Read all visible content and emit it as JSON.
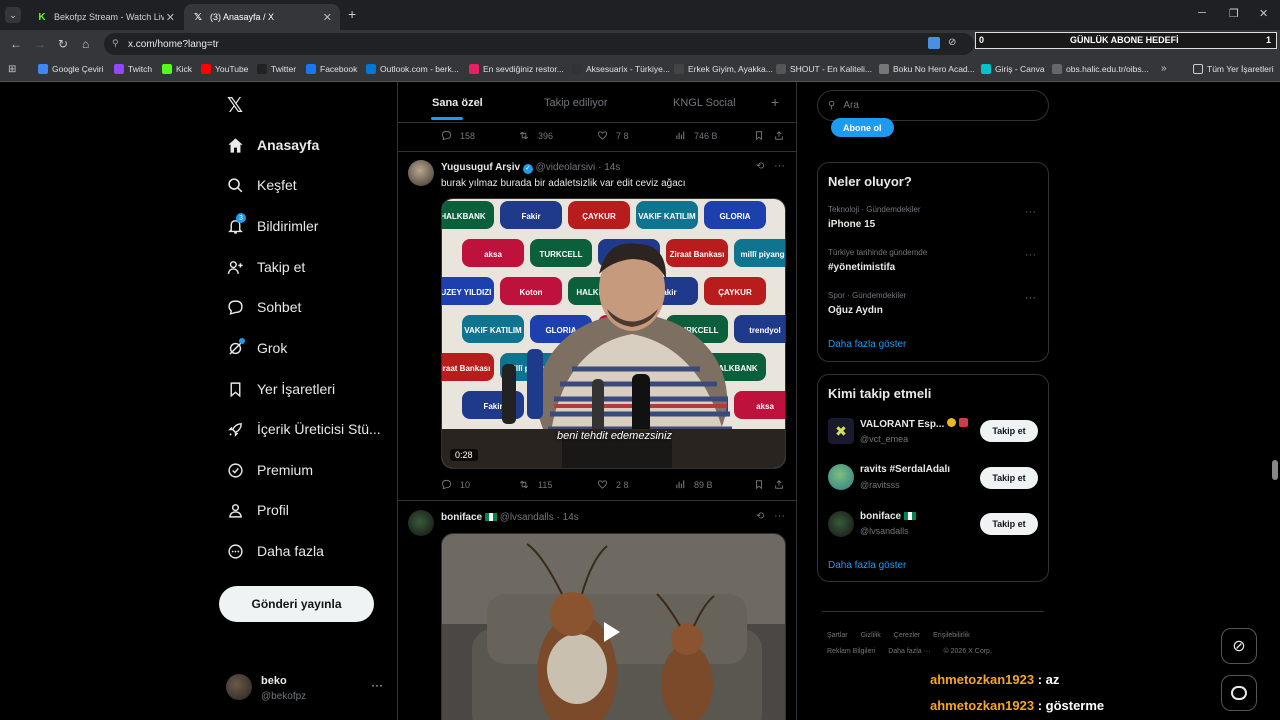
{
  "browser": {
    "tabs": [
      {
        "title": "Bekofpz Stream - Watch Live on",
        "favicon": "kick-icon"
      },
      {
        "title": "(3) Anasayfa / X",
        "favicon": "x-icon"
      }
    ],
    "url": "x.com/home?lang=tr",
    "bookmarks": [
      "Google Çeviri",
      "Twitch",
      "Kick",
      "YouTube",
      "Twitter",
      "Facebook",
      "Outlook.com - berk...",
      "En sevdiğiniz restor...",
      "Aksesuarix - Türkiye...",
      "Erkek Giyim, Ayakka...",
      "SHOUT - En Kaliteli...",
      "Boku No Hero Acad...",
      "Giriş - Canva",
      "obs.halic.edu.tr/oibs..."
    ],
    "all_bookmarks": "Tüm Yer İşaretleri"
  },
  "overlay": {
    "goal_label": "GÜNLÜK ABONE HEDEFİ",
    "goal_current": "0",
    "goal_target": "1"
  },
  "nav": {
    "items": [
      {
        "label": "Anasayfa",
        "icon": "home-icon"
      },
      {
        "label": "Keşfet",
        "icon": "search-icon"
      },
      {
        "label": "Bildirimler",
        "icon": "bell-icon",
        "badge": "3"
      },
      {
        "label": "Takip et",
        "icon": "person-plus-icon"
      },
      {
        "label": "Sohbet",
        "icon": "chat-icon"
      },
      {
        "label": "Grok",
        "icon": "grok-icon"
      },
      {
        "label": "Yer İşaretleri",
        "icon": "bookmark-icon"
      },
      {
        "label": "İçerik Üreticisi Stü...",
        "icon": "rocket-icon"
      },
      {
        "label": "Premium",
        "icon": "verified-icon"
      },
      {
        "label": "Profil",
        "icon": "person-icon"
      },
      {
        "label": "Daha fazla",
        "icon": "more-circle-icon"
      }
    ],
    "post_button": "Gönderi yayınla",
    "user": {
      "name": "beko",
      "handle": "@bekofpz"
    }
  },
  "timeline": {
    "tabs": [
      "Sana özel",
      "Takip ediliyor",
      "KNGL Social"
    ],
    "top_actions": {
      "replies": "158",
      "reposts": "396",
      "likes": "7 8",
      "views": "746 B"
    },
    "tweets": [
      {
        "name": "Yugusuguf Arşiv",
        "handle": "@videolarsivi",
        "time": "14s",
        "text": "burak yılmaz burada bir adaletsizlik var edit ceviz ağacı",
        "caption": "beni tehdit edemezsiniz",
        "duration": "0:28",
        "sponsors": [
          "HALKBANK",
          "Fakir",
          "ÇAYKUR",
          "VAKIF KATILIM",
          "GLORIA",
          "aksa",
          "TURKCELL",
          "trendyol",
          "Ziraat Bankası",
          "millî piyango",
          "KUZEY YILDIZI",
          "Koton"
        ],
        "actions": {
          "replies": "10",
          "reposts": "115",
          "likes": "2 8",
          "views": "89 B"
        }
      },
      {
        "name": "boniface",
        "handle": "@lvsandalls",
        "time": "14s"
      }
    ]
  },
  "sidebar": {
    "search_placeholder": "Ara",
    "subscribe_label": "Abone ol",
    "trends_title": "Neler oluyor?",
    "trends": [
      {
        "meta": "Teknoloji · Gündemdekiler",
        "name": "iPhone 15"
      },
      {
        "meta": "Türkiye tarihinde gündemde",
        "name": "#yönetimistifa"
      },
      {
        "meta": "Spor · Gündemdekiler",
        "name": "Oğuz Aydın"
      }
    ],
    "show_more": "Daha fazla göster",
    "who_title": "Kimi takip etmeli",
    "who": [
      {
        "name": "VALORANT Esp...",
        "handle": "@vct_emea",
        "button": "Takip et"
      },
      {
        "name": "ravits #SerdalAdalı",
        "handle": "@ravitsss",
        "button": "Takip et"
      },
      {
        "name": "boniface",
        "handle": "@lvsandalls",
        "button": "Takip et"
      }
    ],
    "footer": [
      "Şartlar",
      "Gizlilik",
      "Çerezler",
      "Erişilebilirlik",
      "Reklam Bilgileri",
      "Daha fazla ···",
      "© 2026 X Corp."
    ]
  },
  "chat": [
    {
      "user": "ahmetozkan1923",
      "msg": ": az"
    },
    {
      "user": "ahmetozkan1923",
      "msg": ": gösterme"
    }
  ],
  "colors": {
    "accent": "#1d9bf0",
    "chat_user": "#f5a623",
    "verified_gold": "#e8b923"
  }
}
